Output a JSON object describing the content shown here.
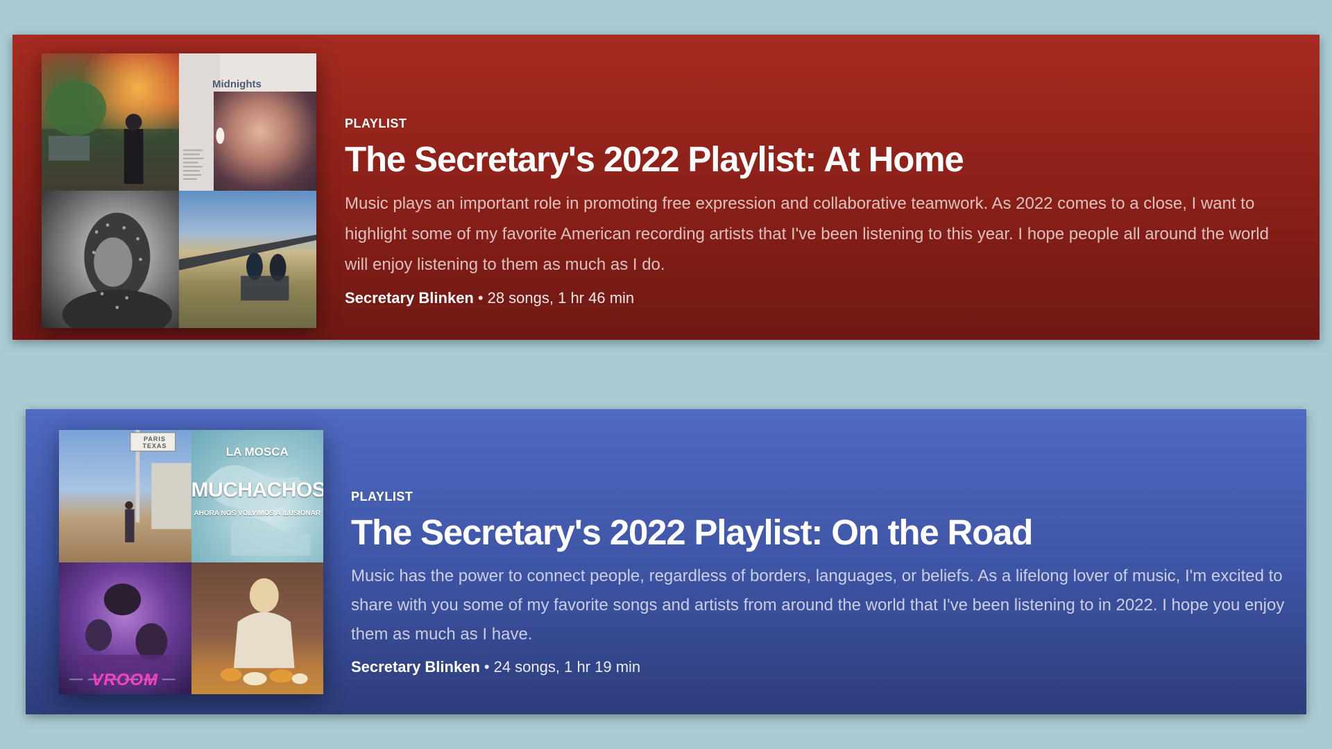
{
  "playlists": [
    {
      "label": "PLAYLIST",
      "title": "The Secretary's 2022 Playlist: At Home",
      "description": "Music plays an important role in promoting free expression and collaborative teamwork. As 2022 comes to a close, I want to highlight some of my favorite American recording artists that I've been listening to this year. I hope people all around the world will enjoy listening to them as much as I do.",
      "owner": "Secretary Blinken",
      "separator": "•",
      "stats": "28 songs, 1 hr 46 min",
      "covers": [
        {
          "icon": "album-cover-icon",
          "text": ""
        },
        {
          "icon": "album-cover-icon",
          "text": "Midnights"
        },
        {
          "icon": "album-cover-icon",
          "text": ""
        },
        {
          "icon": "album-cover-icon",
          "text": ""
        }
      ],
      "accent": "#a62b21"
    },
    {
      "label": "PLAYLIST",
      "title": "The Secretary's 2022 Playlist: On the Road",
      "description": "Music has the power to connect people, regardless of borders, languages, or beliefs. As a lifelong lover of music, I'm excited to share with you some of my favorite songs and artists from around the world that I've been listening to in 2022. I hope you enjoy them as much as I have.",
      "owner": "Secretary Blinken",
      "separator": "•",
      "stats": "24 songs, 1 hr 19 min",
      "covers": [
        {
          "icon": "album-cover-icon",
          "text": "PARIS TEXAS"
        },
        {
          "icon": "album-cover-icon",
          "text": "LA MOSCA",
          "text2": "MUCHACHOS",
          "text3": "AHORA NOS VOLVIMOS A ILUSIONAR"
        },
        {
          "icon": "album-cover-icon",
          "text": "VROOM"
        },
        {
          "icon": "album-cover-icon",
          "text": ""
        }
      ],
      "accent": "#4f6ac2"
    }
  ]
}
